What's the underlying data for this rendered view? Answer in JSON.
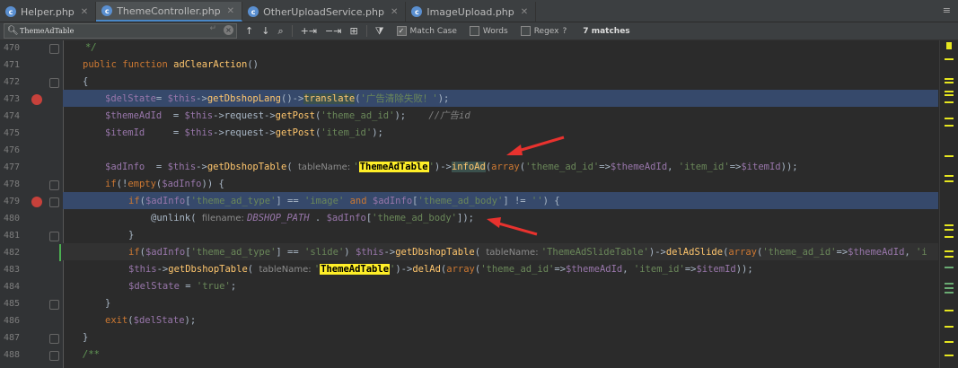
{
  "tabs": [
    {
      "label": "Helper.php",
      "active": false
    },
    {
      "label": "ThemeController.php",
      "active": true
    },
    {
      "label": "OtherUploadService.php",
      "active": false
    },
    {
      "label": "ImageUpload.php",
      "active": false
    }
  ],
  "tab_overflow": "≡",
  "find": {
    "query": "ThemeAdTable",
    "match_case_label": "Match Case",
    "words_label": "Words",
    "regex_label": "Regex",
    "regex_help": "?",
    "matches": "7 matches"
  },
  "lines": [
    {
      "n": "470"
    },
    {
      "n": "471"
    },
    {
      "n": "472"
    },
    {
      "n": "473"
    },
    {
      "n": "474"
    },
    {
      "n": "475"
    },
    {
      "n": "476"
    },
    {
      "n": "477"
    },
    {
      "n": "478"
    },
    {
      "n": "479"
    },
    {
      "n": "480"
    },
    {
      "n": "481"
    },
    {
      "n": "482"
    },
    {
      "n": "483"
    },
    {
      "n": "484"
    },
    {
      "n": "485"
    },
    {
      "n": "486"
    },
    {
      "n": "487"
    },
    {
      "n": "488"
    }
  ],
  "code": {
    "l470": "*/",
    "l471_kw": "public function ",
    "l471_fn": "adClearAction",
    "l471_rest": "()",
    "l472": "{",
    "l473_v1": "$delState",
    "l473_eq": "= ",
    "l473_v2": "$this",
    "l473_op": "->",
    "l473_fn1": "getDbshopLang",
    "l473_mid": "()->",
    "l473_fn2": "translate",
    "l473_p": "(",
    "l473_str": "'广告清除失败！'",
    "l473_end": ");",
    "l474_v": "$themeAdId",
    "l474_eq": "  = ",
    "l474_this": "$this",
    "l474_a": "->request->",
    "l474_fn": "getPost",
    "l474_p": "(",
    "l474_str": "'theme_ad_id'",
    "l474_end": ");",
    "l474_cmt": "//广告id",
    "l475_v": "$itemId",
    "l475_eq": "     = ",
    "l475_this": "$this",
    "l475_a": "->request->",
    "l475_fn": "getPost",
    "l475_p": "(",
    "l475_str": "'item_id'",
    "l475_end": ");",
    "l477_v": "$adInfo",
    "l477_eq": "  = ",
    "l477_this": "$this",
    "l477_a": "->",
    "l477_fn": "getDbshopTable",
    "l477_p": "( ",
    "l477_hint": "tableName: ",
    "l477_q1": "'",
    "l477_match": "ThemeAdTable",
    "l477_q2": "'",
    "l477_b": ")->",
    "l477_fn2": "infoAd",
    "l477_c": "(",
    "l477_kw": "array",
    "l477_d": "(",
    "l477_s1": "'theme_ad_id'",
    "l477_e": "=>",
    "l477_v2": "$themeAdId",
    "l477_f": ", ",
    "l477_s2": "'item_id'",
    "l477_g": "=>",
    "l477_v3": "$itemId",
    "l477_h": "));",
    "l478_kw": "if",
    "l478_a": "(!",
    "l478_kw2": "empty",
    "l478_b": "(",
    "l478_v": "$adInfo",
    "l478_c": ")) {",
    "l479_kw": "if",
    "l479_a": "(",
    "l479_v": "$adInfo",
    "l479_b": "[",
    "l479_s1": "'theme_ad_type'",
    "l479_c": "] == ",
    "l479_s2": "'image'",
    "l479_and": " and ",
    "l479_v2": "$adInfo",
    "l479_d": "[",
    "l479_s3": "'theme_ad_body'",
    "l479_e": "] != ",
    "l479_s4": "''",
    "l479_f": ") {",
    "l480_at": "@unlink",
    "l480_p": "( ",
    "l480_hint": "filename: ",
    "l480_const": "DBSHOP_PATH",
    "l480_a": " . ",
    "l480_v": "$adInfo",
    "l480_b": "[",
    "l480_s": "'theme_ad_body'",
    "l480_c": "]);",
    "l481": "}",
    "l482_kw": "if",
    "l482_a": "(",
    "l482_v": "$adInfo",
    "l482_b": "[",
    "l482_s1": "'theme_ad_type'",
    "l482_c": "] == ",
    "l482_s2": "'slide'",
    "l482_d": ") ",
    "l482_this": "$this",
    "l482_e": "->",
    "l482_fn": "getDbshopTable",
    "l482_f": "( ",
    "l482_hint": "tableName: ",
    "l482_s3": "'ThemeAdSlideTable'",
    "l482_g": ")->",
    "l482_fn2": "delAdSlide",
    "l482_h": "(",
    "l482_kw2": "array",
    "l482_i": "(",
    "l482_s4": "'theme_ad_id'",
    "l482_j": "=>",
    "l482_v2": "$themeAdId",
    "l482_k": ", ",
    "l482_s5": "'i",
    "l483_this": "$this",
    "l483_a": "->",
    "l483_fn": "getDbshopTable",
    "l483_p": "( ",
    "l483_hint": "tableName: ",
    "l483_q1": "'",
    "l483_match": "ThemeAdTable",
    "l483_q2": "'",
    "l483_b": ")->",
    "l483_fn2": "delAd",
    "l483_c": "(",
    "l483_kw": "array",
    "l483_d": "(",
    "l483_s1": "'theme_ad_id'",
    "l483_e": "=>",
    "l483_v": "$themeAdId",
    "l483_f": ", ",
    "l483_s2": "'item_id'",
    "l483_g": "=>",
    "l483_v2": "$itemId",
    "l483_h": "));",
    "l484_v": "$delState",
    "l484_eq": " = ",
    "l484_s": "'true'",
    "l484_end": ";",
    "l485": "}",
    "l486_kw": "exit",
    "l486_a": "(",
    "l486_v": "$delState",
    "l486_b": ");",
    "l487": "}",
    "l488": "/**"
  },
  "colors": {
    "accent": "#4a88c7",
    "breakpoint": "#c7413b",
    "match": "#ffef28",
    "arrow": "#e8322e"
  }
}
